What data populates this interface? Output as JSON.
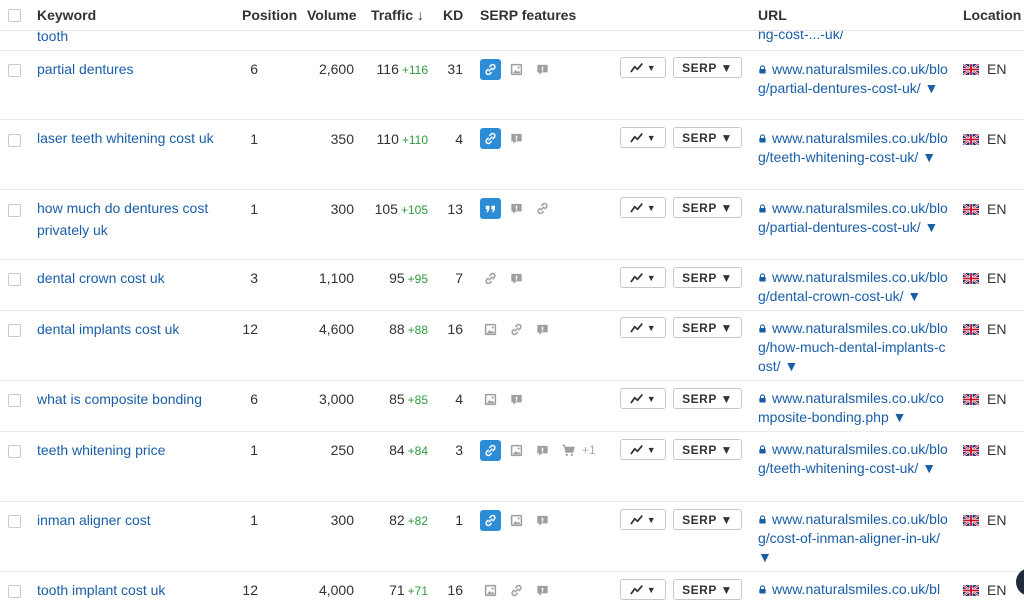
{
  "header": {
    "keyword": "Keyword",
    "position": "Position",
    "volume": "Volume",
    "traffic": "Traffic ↓",
    "kd": "KD",
    "serp_features": "SERP features",
    "url": "URL",
    "location": "Location"
  },
  "partial_row": {
    "keyword": "tooth",
    "url": "ng-cost-...-uk/"
  },
  "buttons": {
    "chart_label": "▼",
    "serp_label": "SERP ▼"
  },
  "rows": [
    {
      "keyword": "partial dentures",
      "position": "6",
      "volume": "2,600",
      "traffic": "116",
      "delta": "+116",
      "kd": "31",
      "url": "www.naturalsmiles.co.uk/blog/partial-dentures-cost-uk/ ▼",
      "lang": "EN"
    },
    {
      "keyword": "laser teeth whitening cost uk",
      "position": "1",
      "volume": "350",
      "traffic": "110",
      "delta": "+110",
      "kd": "4",
      "url": "www.naturalsmiles.co.uk/blog/teeth-whitening-cost-uk/ ▼",
      "lang": "EN"
    },
    {
      "keyword": "how much do dentures cost privately uk",
      "position": "1",
      "volume": "300",
      "traffic": "105",
      "delta": "+105",
      "kd": "13",
      "url": "www.naturalsmiles.co.uk/blog/partial-dentures-cost-uk/ ▼",
      "lang": "EN"
    },
    {
      "keyword": "dental crown cost uk",
      "position": "3",
      "volume": "1,100",
      "traffic": "95",
      "delta": "+95",
      "kd": "7",
      "url": "www.naturalsmiles.co.uk/blog/dental-crown-cost-uk/ ▼",
      "lang": "EN"
    },
    {
      "keyword": "dental implants cost uk",
      "position": "12",
      "volume": "4,600",
      "traffic": "88",
      "delta": "+88",
      "kd": "16",
      "url": "www.naturalsmiles.co.uk/blog/how-much-dental-implants-cost/ ▼",
      "lang": "EN"
    },
    {
      "keyword": "what is composite bonding",
      "position": "6",
      "volume": "3,000",
      "traffic": "85",
      "delta": "+85",
      "kd": "4",
      "url": "www.naturalsmiles.co.uk/composite-bonding.php ▼",
      "lang": "EN"
    },
    {
      "keyword": "teeth whitening price",
      "position": "1",
      "volume": "250",
      "traffic": "84",
      "delta": "+84",
      "kd": "3",
      "url": "www.naturalsmiles.co.uk/blog/teeth-whitening-cost-uk/ ▼",
      "lang": "EN",
      "extra_features": "+1"
    },
    {
      "keyword": "inman aligner cost",
      "position": "1",
      "volume": "300",
      "traffic": "82",
      "delta": "+82",
      "kd": "1",
      "url": "www.naturalsmiles.co.uk/blog/cost-of-inman-aligner-in-uk/ ▼",
      "lang": "EN"
    },
    {
      "keyword": "tooth implant cost uk",
      "position": "12",
      "volume": "4,000",
      "traffic": "71",
      "delta": "+71",
      "kd": "16",
      "url": "www.naturalsmiles.co.uk/bl",
      "lang": "EN"
    }
  ],
  "colors": {
    "link": "#1a5ea8",
    "delta": "#2e9b3e",
    "feature_active": "#2d8cd6"
  }
}
